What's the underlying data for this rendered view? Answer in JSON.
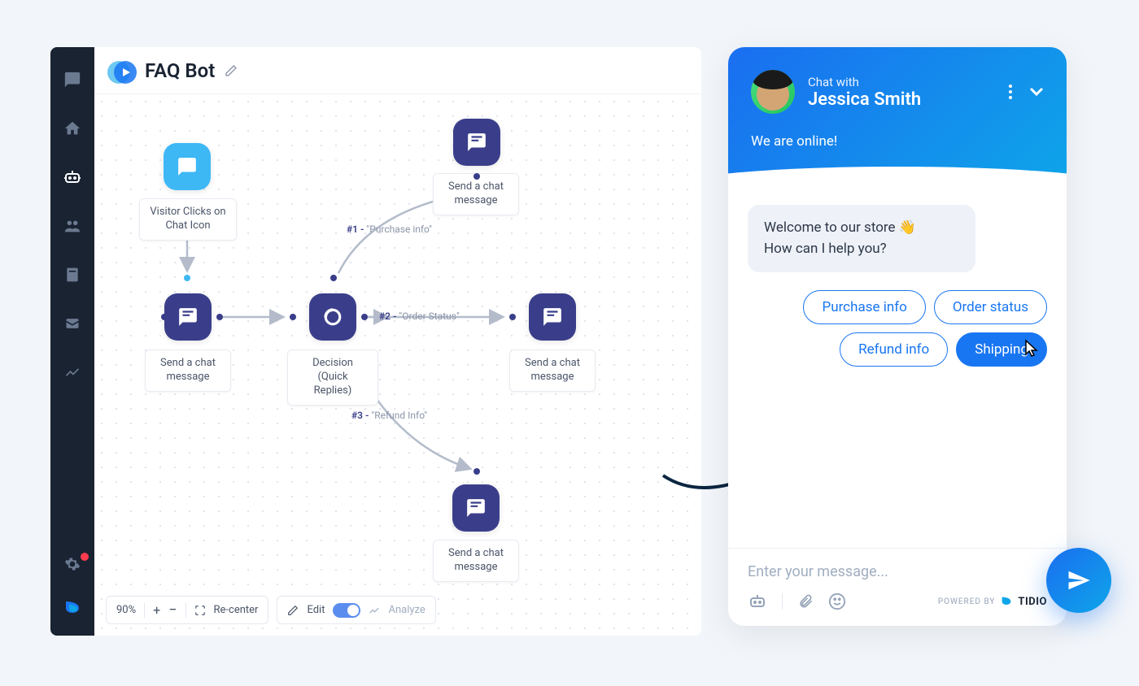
{
  "app": {
    "title": "FAQ Bot"
  },
  "canvas": {
    "zoom": "90%",
    "recenter": "Re-center",
    "edit": "Edit",
    "analyze": "Analyze",
    "nodes": {
      "trigger": "Visitor Clicks on Chat Icon",
      "send1": "Send a chat message",
      "send2": "Send a chat message",
      "decision": "Decision (Quick Replies)",
      "send3": "Send a chat message",
      "send4": "Send a chat message"
    },
    "branches": {
      "b1_num": "#1 -",
      "b1_text": "\"Purchase info\"",
      "b2_num": "#2 -",
      "b2_text": "\"Order Status\"",
      "b3_num": "#3 -",
      "b3_text": "\"Refund Info\""
    }
  },
  "chat": {
    "chat_with": "Chat with",
    "name": "Jessica Smith",
    "online": "We are online!",
    "welcome_line1": "Welcome to our store 👋",
    "welcome_line2": "How can I help you?",
    "quick_replies": {
      "q1": "Purchase info",
      "q2": "Order status",
      "q3": "Refund info",
      "q4": "Shipping"
    },
    "input_placeholder": "Enter your message...",
    "powered_by": "POWERED BY",
    "brand": "TIDIO"
  }
}
